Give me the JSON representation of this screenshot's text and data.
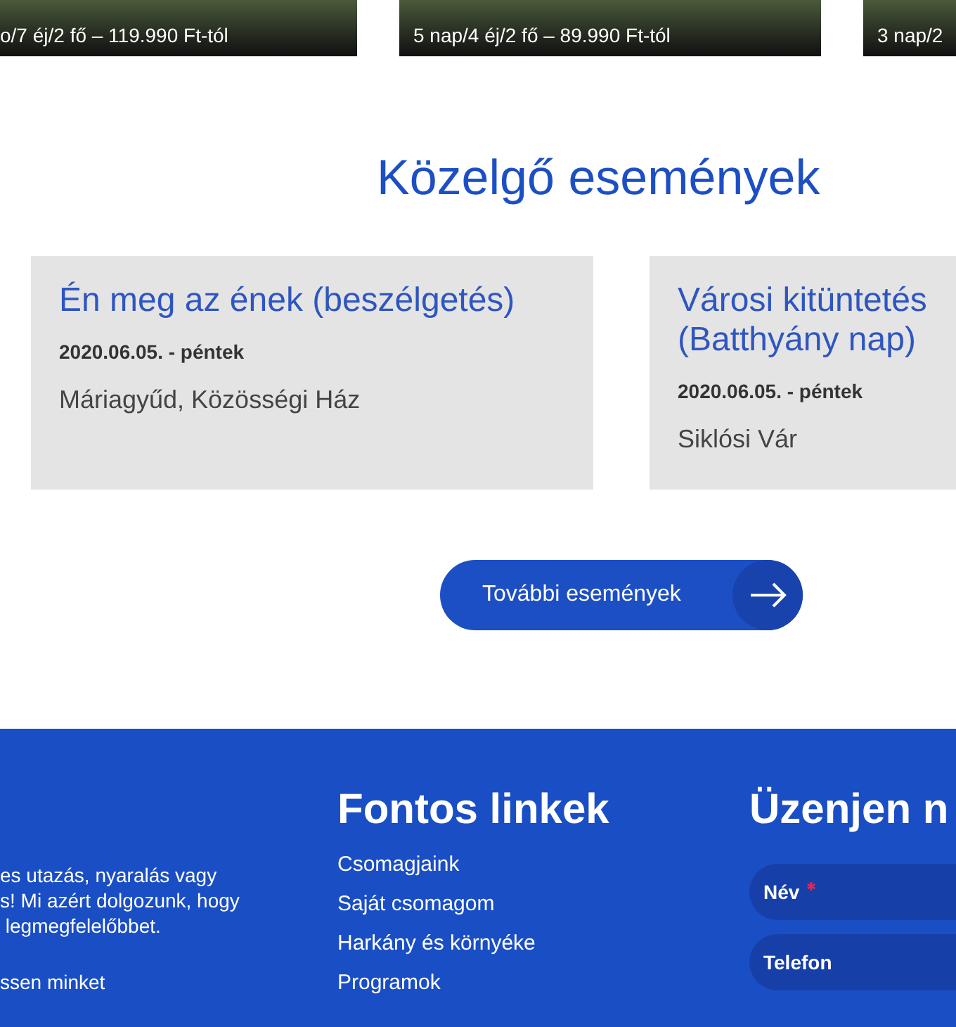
{
  "offers": [
    {
      "subtitle": "o/7 éj/2 fő – 119.990 Ft-tól"
    },
    {
      "subtitle": "5 nap/4 éj/2 fő – 89.990 Ft-tól"
    },
    {
      "subtitle": "3 nap/2"
    }
  ],
  "events_section": {
    "title": "Közelgő események",
    "events": [
      {
        "title": "Én meg az ének (beszélgetés)",
        "date": "2020.06.05. - péntek",
        "place": "Máriagyűd, Közösségi Ház"
      },
      {
        "title": "Városi kitüntetés (Batthyány nap)",
        "date": "2020.06.05. - péntek",
        "place": "Siklósi Vár"
      }
    ],
    "more_button": "További események"
  },
  "footer": {
    "about_lines": [
      "es utazás, nyaralás vagy",
      "s! Mi azért dolgozunk, hogy",
      " legmegfelelőbbet."
    ],
    "contact_link": "ssen minket",
    "links_title": "Fontos linkek",
    "links": [
      "Csomagjaink",
      "Saját csomagom",
      "Harkány és környéke",
      "Programok"
    ],
    "form_title": "Üzenjen n",
    "fields": [
      {
        "placeholder": "Név",
        "required": true
      },
      {
        "placeholder": "Telefon",
        "required": false
      }
    ]
  }
}
